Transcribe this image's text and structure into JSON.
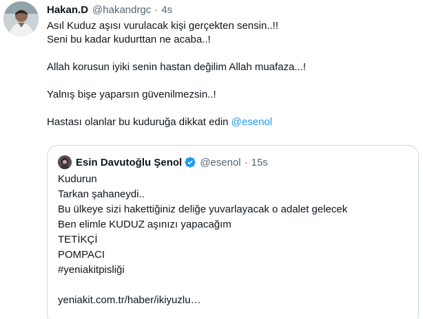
{
  "tweet": {
    "author_name": "Hakan.D",
    "author_handle": "@hakandrgc",
    "separator": "·",
    "time": "4s",
    "lines": [
      "Asıl Kuduz aşısı vurulacak kişi gerçekten sensin..!!",
      "Seni bu kadar kudurttan ne acaba..!",
      "",
      "Allah korusun iyiki senin hastan değilim Allah muafaza...!",
      "",
      "Yalnış bişe yaparsın güvenilmezsin..!",
      ""
    ],
    "last_line_prefix": "Hastası olanlar bu kuduruğa dikkat edin ",
    "last_line_mention": "@esenol"
  },
  "quote": {
    "author_name": "Esin Davutoğlu Şenol",
    "author_handle": "@esenol",
    "separator": "·",
    "time": "15s",
    "lines": [
      "Kudurun",
      "Tarkan şahaneydi..",
      "Bu ülkeye sizi hakettiğiniz deliğe yuvarlayacak o adalet gelecek",
      "Ben elimle KUDUZ aşınızı yapacağım",
      "TETİKÇİ",
      "POMPACI",
      "#yeniakitpisliği",
      "",
      "yeniakit.com.tr/haber/ikiyuzlu…"
    ]
  },
  "colors": {
    "text": "#0f1419",
    "secondary": "#536471",
    "link": "#1d9bf0",
    "border": "#cfd9de",
    "verified": "#1d9bf0"
  },
  "icons": {
    "verified": "verified-badge-icon"
  }
}
